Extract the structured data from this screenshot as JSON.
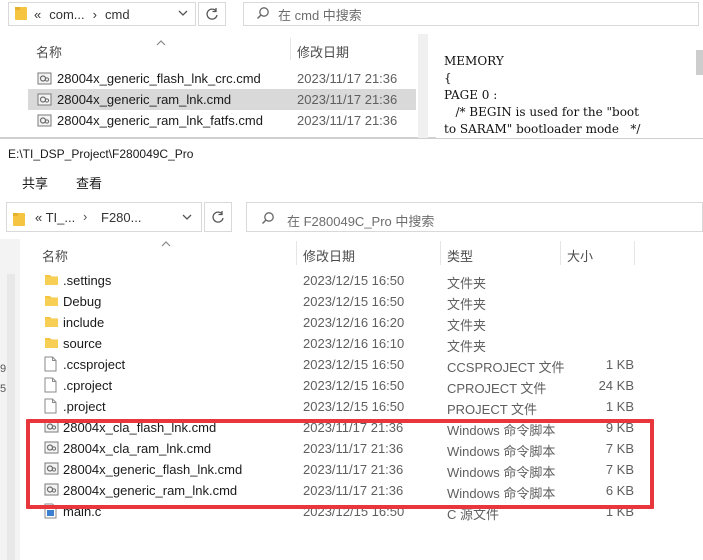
{
  "background_window": {
    "breadcrumb": [
      "«",
      "com...",
      "›",
      "cmd"
    ],
    "search_placeholder": "在 cmd 中搜索",
    "columns": {
      "name": "名称",
      "date": "修改日期"
    },
    "files": [
      {
        "name": "28004x_generic_flash_lnk_crc.cmd",
        "date": "2023/11/17 21:36",
        "selected": false
      },
      {
        "name": "28004x_generic_ram_lnk.cmd",
        "date": "2023/11/17 21:36",
        "selected": true
      },
      {
        "name": "28004x_generic_ram_lnk_fatfs.cmd",
        "date": "2023/11/17 21:36",
        "selected": false
      }
    ],
    "preview_lines": [
      "MEMORY",
      "{",
      "PAGE 0 :",
      "   /* BEGIN is used for the \"boot",
      "to SARAM\" bootloader mode   */"
    ]
  },
  "window": {
    "title": "E:\\TI_DSP_Project\\F280049C_Pro",
    "ribbon_tabs": [
      "共享",
      "查看"
    ],
    "breadcrumb": {
      "lead": "«  TI_...",
      "sep": "›",
      "current": "F280..."
    },
    "search_placeholder": "在 F280049C_Pro 中搜索",
    "columns": {
      "name": "名称",
      "date": "修改日期",
      "type": "类型",
      "size": "大小"
    },
    "left_edge_chars": [
      "9",
      "5"
    ],
    "files": [
      {
        "icon": "folder",
        "name": ".settings",
        "date": "2023/12/15 16:50",
        "type": "文件夹",
        "size": ""
      },
      {
        "icon": "folder",
        "name": "Debug",
        "date": "2023/12/15 16:50",
        "type": "文件夹",
        "size": ""
      },
      {
        "icon": "folder",
        "name": "include",
        "date": "2023/12/16 16:20",
        "type": "文件夹",
        "size": ""
      },
      {
        "icon": "folder",
        "name": "source",
        "date": "2023/12/16 16:10",
        "type": "文件夹",
        "size": ""
      },
      {
        "icon": "file",
        "name": ".ccsproject",
        "date": "2023/12/15 16:50",
        "type": "CCSPROJECT 文件",
        "size": "1 KB"
      },
      {
        "icon": "file",
        "name": ".cproject",
        "date": "2023/12/15 16:50",
        "type": "CPROJECT 文件",
        "size": "24 KB"
      },
      {
        "icon": "file",
        "name": ".project",
        "date": "2023/12/15 16:50",
        "type": "PROJECT 文件",
        "size": "1 KB"
      },
      {
        "icon": "cmd",
        "name": "28004x_cla_flash_lnk.cmd",
        "date": "2023/11/17 21:36",
        "type": "Windows 命令脚本",
        "size": "9 KB"
      },
      {
        "icon": "cmd",
        "name": "28004x_cla_ram_lnk.cmd",
        "date": "2023/11/17 21:36",
        "type": "Windows 命令脚本",
        "size": "7 KB"
      },
      {
        "icon": "cmd",
        "name": "28004x_generic_flash_lnk.cmd",
        "date": "2023/11/17 21:36",
        "type": "Windows 命令脚本",
        "size": "7 KB"
      },
      {
        "icon": "cmd",
        "name": "28004x_generic_ram_lnk.cmd",
        "date": "2023/11/17 21:36",
        "type": "Windows 命令脚本",
        "size": "6 KB"
      },
      {
        "icon": "c-file",
        "name": "main.c",
        "date": "2023/12/15 16:50",
        "type": "C 源文件",
        "size": "1 KB"
      }
    ],
    "highlight_color": "#e8363c"
  }
}
